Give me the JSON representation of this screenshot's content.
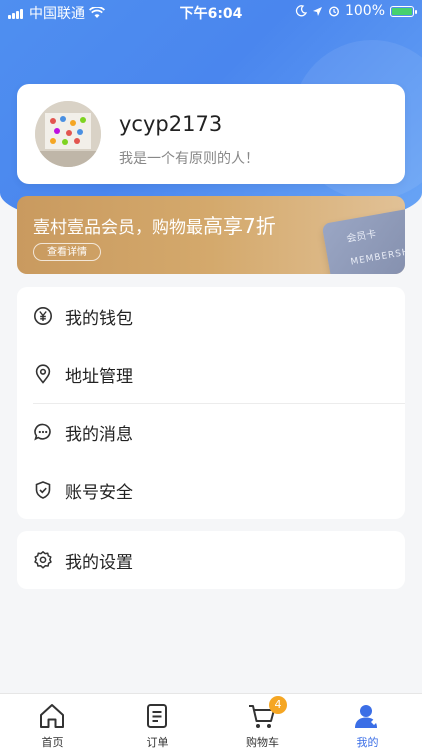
{
  "status_bar": {
    "carrier": "中国联通",
    "time": "下午6:04",
    "battery": "100%"
  },
  "profile": {
    "username": "ycyp2173",
    "motto": "我是一个有原则的人！"
  },
  "banner": {
    "title_prefix": "壹村壹品会员，购物最",
    "title_highlight": "高享7折",
    "button_label": "查看详情",
    "card_title": "会员卡",
    "card_text": "MEMBERSHI"
  },
  "menu": {
    "items": [
      {
        "label": "我的钱包",
        "icon": "yen-icon"
      },
      {
        "label": "地址管理",
        "icon": "location-pin-icon"
      },
      {
        "label": "我的消息",
        "icon": "message-icon"
      },
      {
        "label": "账号安全",
        "icon": "shield-check-icon"
      }
    ],
    "settings": {
      "label": "我的设置",
      "icon": "gear-icon"
    }
  },
  "tabbar": {
    "tabs": [
      {
        "label": "首页",
        "icon": "home-icon"
      },
      {
        "label": "订单",
        "icon": "order-icon"
      },
      {
        "label": "购物车",
        "icon": "cart-icon",
        "badge": "4"
      },
      {
        "label": "我的",
        "icon": "user-icon",
        "active": true
      }
    ]
  },
  "colors": {
    "primary": "#4a86ee",
    "active_tab": "#3b6ee6",
    "badge": "#f5a623",
    "banner_gold": "#d4a96c"
  }
}
